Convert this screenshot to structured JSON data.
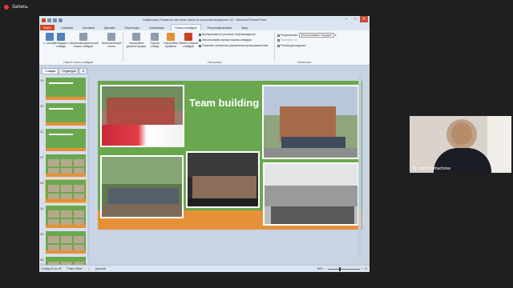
{
  "recording": {
    "label": "Запись"
  },
  "window": {
    "title": "Горбачова_Розвиток системи освіти в сільській місцевості 02 - Microsoft PowerPoint",
    "controls": [
      "–",
      "□",
      "✕"
    ]
  },
  "ribbon_tabs": [
    {
      "label": "Файл",
      "kind": "file"
    },
    {
      "label": "Главная",
      "kind": "normal"
    },
    {
      "label": "Вставка",
      "kind": "normal"
    },
    {
      "label": "Дизайн",
      "kind": "normal"
    },
    {
      "label": "Переходы",
      "kind": "normal"
    },
    {
      "label": "Анимация",
      "kind": "normal"
    },
    {
      "label": "Показ слайдов",
      "kind": "active"
    },
    {
      "label": "Рецензирование",
      "kind": "normal"
    },
    {
      "label": "Вид",
      "kind": "normal"
    }
  ],
  "ribbon": {
    "buttons": {
      "from_start": "С начала",
      "from_current": "С текущего слайда",
      "broadcast": "Широковещательный показ слайдов",
      "custom_show": "Произвольный показ",
      "setup": "Настройка демонстрации",
      "hide_slide": "Скрыть слайд",
      "rehearse": "Настройка времени",
      "record": "Запись показа слайдов"
    },
    "checks": {
      "play_narrations": "Воспроизвести речевое сопровождение",
      "use_timings": "Использовать время показа слайдов",
      "show_controls": "Показать элементы управления проигрывателем",
      "resolution_label": "Разрешение:",
      "resolution_value": "Использовать текущее",
      "show_on_label": "Показать на:",
      "presenter_view": "Режим докладчика"
    },
    "groups": {
      "start": "Начать показ слайдов",
      "setup": "Настройка",
      "monitors": "Мониторы"
    }
  },
  "sidebar": {
    "tabs": [
      "Слайды",
      "Структура"
    ],
    "thumbnails": [
      {
        "num": "19",
        "selected": false
      },
      {
        "num": "20",
        "selected": false
      },
      {
        "num": "21",
        "selected": false
      },
      {
        "num": "22",
        "selected": false
      },
      {
        "num": "23",
        "selected": true
      },
      {
        "num": "24",
        "selected": false
      },
      {
        "num": "25",
        "selected": false
      },
      {
        "num": "26",
        "selected": false
      }
    ]
  },
  "slide": {
    "title": "Team building"
  },
  "status": {
    "slide_of": "Слайд 23 из 48",
    "theme": "\"Тема Office\"",
    "lang": "русский",
    "zoom": "59%"
  },
  "webcam": {
    "name": "Iryna Horbachova"
  },
  "colors": {
    "slide_green": "#6aa84f",
    "slide_orange": "#e69138",
    "file_tab": "#d24726",
    "selected_thumb": "#f2c14e"
  }
}
